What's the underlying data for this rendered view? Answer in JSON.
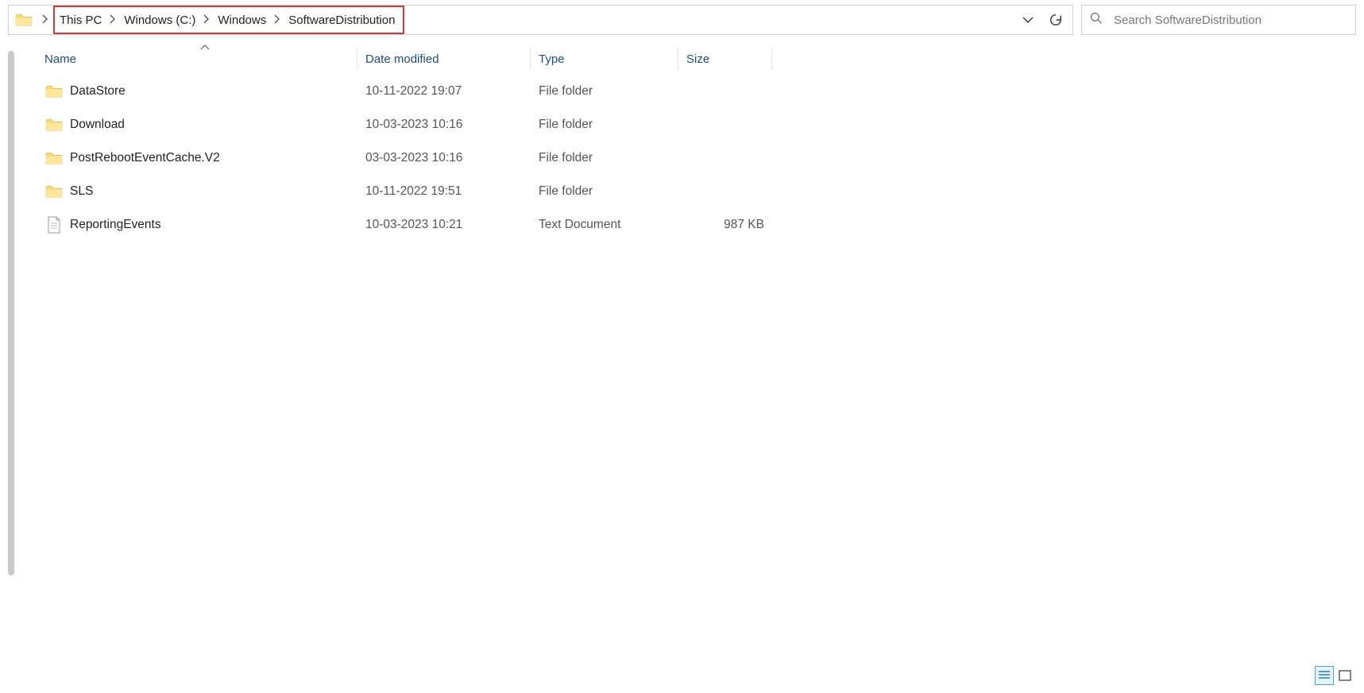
{
  "breadcrumbs": {
    "items": [
      "This PC",
      "Windows (C:)",
      "Windows",
      "SoftwareDistribution"
    ]
  },
  "search": {
    "placeholder": "Search SoftwareDistribution"
  },
  "columns": {
    "name": "Name",
    "date": "Date modified",
    "type": "Type",
    "size": "Size"
  },
  "files": [
    {
      "icon": "folder",
      "name": "DataStore",
      "date": "10-11-2022 19:07",
      "type": "File folder",
      "size": ""
    },
    {
      "icon": "folder",
      "name": "Download",
      "date": "10-03-2023 10:16",
      "type": "File folder",
      "size": ""
    },
    {
      "icon": "folder",
      "name": "PostRebootEventCache.V2",
      "date": "03-03-2023 10:16",
      "type": "File folder",
      "size": ""
    },
    {
      "icon": "folder",
      "name": "SLS",
      "date": "10-11-2022 19:51",
      "type": "File folder",
      "size": ""
    },
    {
      "icon": "text",
      "name": "ReportingEvents",
      "date": "10-03-2023 10:21",
      "type": "Text Document",
      "size": "987 KB"
    }
  ]
}
